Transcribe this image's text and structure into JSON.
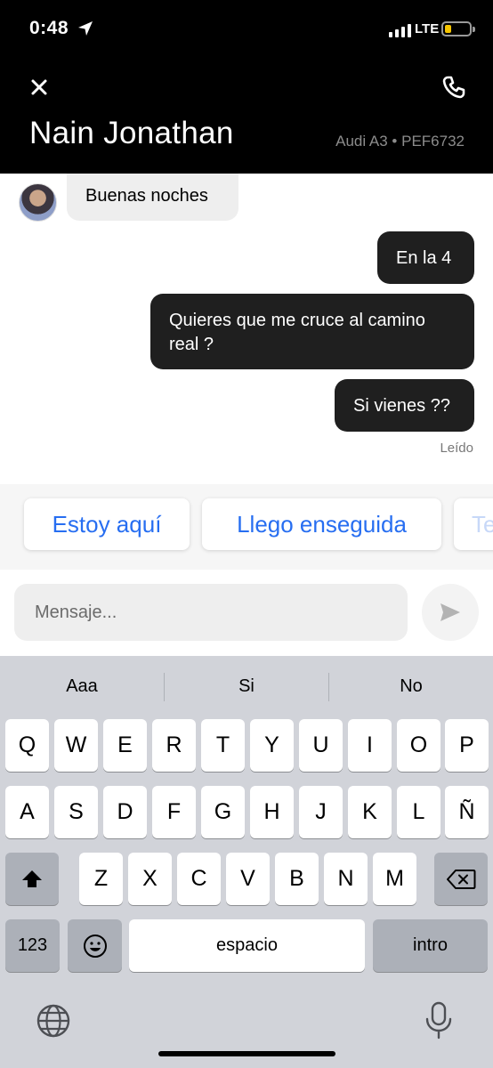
{
  "status_bar": {
    "time": "0:48",
    "network": "LTE"
  },
  "header": {
    "close_icon": "close-icon",
    "phone_icon": "phone-icon",
    "driver_name": "Nain Jonathan",
    "vehicle": "Audi A3 • PEF6732"
  },
  "messages": [
    {
      "direction": "in",
      "text": "Buenas noches"
    },
    {
      "direction": "out",
      "text": "En la 4"
    },
    {
      "direction": "out",
      "text": "Quieres que me cruce al camino real ?"
    },
    {
      "direction": "out",
      "text": "Si vienes ??"
    }
  ],
  "read_status": "Leído",
  "quick_replies": [
    "Estoy aquí",
    "Llego enseguida",
    "Te"
  ],
  "composer": {
    "placeholder": "Mensaje...",
    "value": ""
  },
  "keyboard": {
    "suggestions": [
      "Aaa",
      "Si",
      "No"
    ],
    "row1": [
      "Q",
      "W",
      "E",
      "R",
      "T",
      "Y",
      "U",
      "I",
      "O",
      "P"
    ],
    "row2": [
      "A",
      "S",
      "D",
      "F",
      "G",
      "H",
      "J",
      "K",
      "L",
      "Ñ"
    ],
    "row3": [
      "Z",
      "X",
      "C",
      "V",
      "B",
      "N",
      "M"
    ],
    "numbers_key": "123",
    "space_key": "espacio",
    "return_key": "intro"
  },
  "colors": {
    "accent": "#276ef1",
    "header_bg": "#000000",
    "bubble_out": "#1f1f1f",
    "bubble_in": "#eeeeee"
  }
}
